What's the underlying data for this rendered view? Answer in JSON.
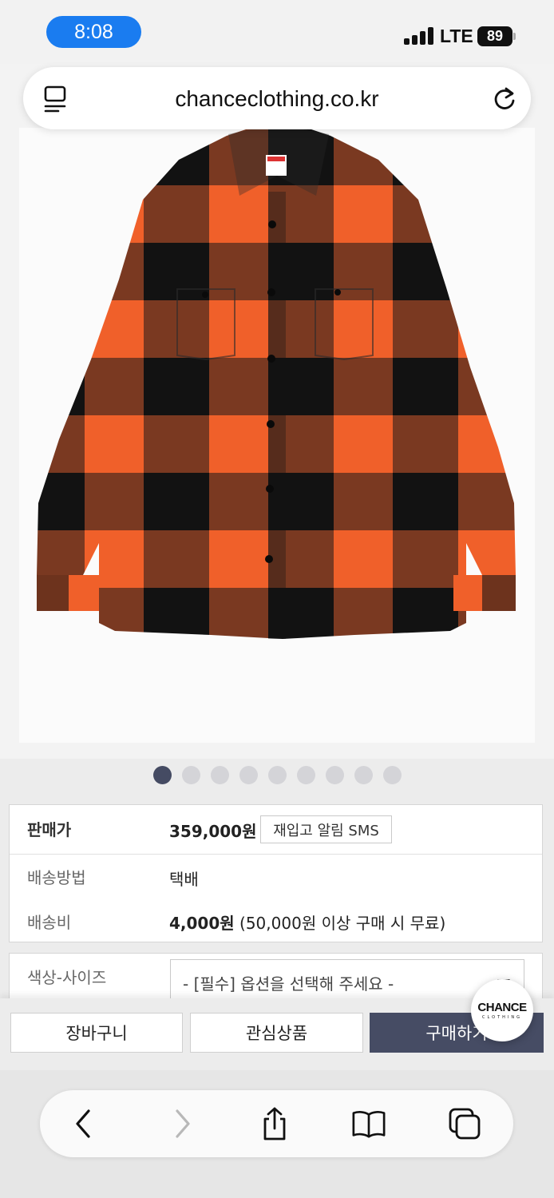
{
  "status_bar": {
    "time": "8:08",
    "network": "LTE",
    "battery": "89"
  },
  "browser": {
    "url": "chanceclothing.co.kr"
  },
  "gallery": {
    "dot_count": 9,
    "active_index": 0
  },
  "product_info": {
    "price_label": "판매가",
    "price_value": "359,000원",
    "restock_button": "재입고 알림 SMS",
    "shipping_method_label": "배송방법",
    "shipping_method_value": "택배",
    "shipping_fee_label": "배송비",
    "shipping_fee_value": "4,000원",
    "shipping_fee_note": "(50,000원 이상 구매 시 무료)"
  },
  "option": {
    "label": "색상-사이즈",
    "placeholder": "- [필수] 옵션을 선택해 주세요 -"
  },
  "actions": {
    "cart": "장바구니",
    "wishlist": "관심상품",
    "buy": "구매하기"
  },
  "badge": {
    "main": "CHANCE",
    "sub": "CLOTHING"
  },
  "colors": {
    "accent": "#464c64",
    "status_pill": "#1a7cf0",
    "plaid_orange": "#f0602a",
    "plaid_black": "#151515"
  }
}
